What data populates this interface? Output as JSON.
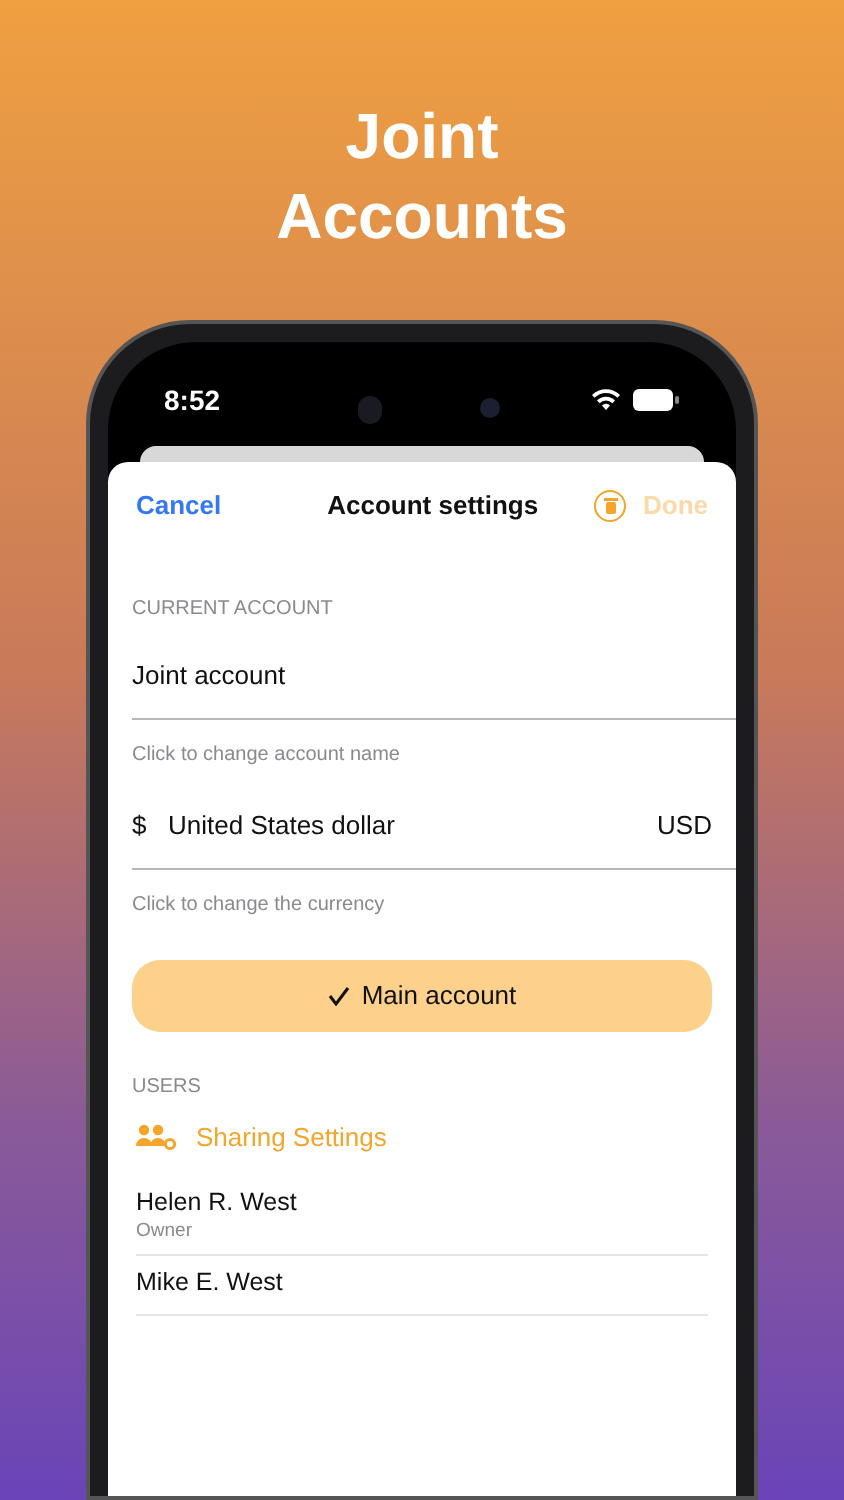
{
  "headline": "Joint Accounts",
  "status_bar": {
    "time": "8:52"
  },
  "nav": {
    "cancel": "Cancel",
    "title": "Account settings",
    "done": {
      "label": "Done",
      "disabled": true
    }
  },
  "current_account": {
    "header": "CURRENT ACCOUNT",
    "name": "Joint account",
    "name_hint": "Click to change account name",
    "currency_symbol": "$",
    "currency_name": "United States dollar",
    "currency_code": "USD",
    "currency_hint": "Click to change the currency"
  },
  "main_account": {
    "label": "Main account",
    "checked": true
  },
  "users": {
    "header": "USERS",
    "sharing": "Sharing Settings",
    "list": [
      {
        "name": "Helen R. West",
        "role": "Owner"
      },
      {
        "name": "Mike E. West"
      }
    ]
  }
}
